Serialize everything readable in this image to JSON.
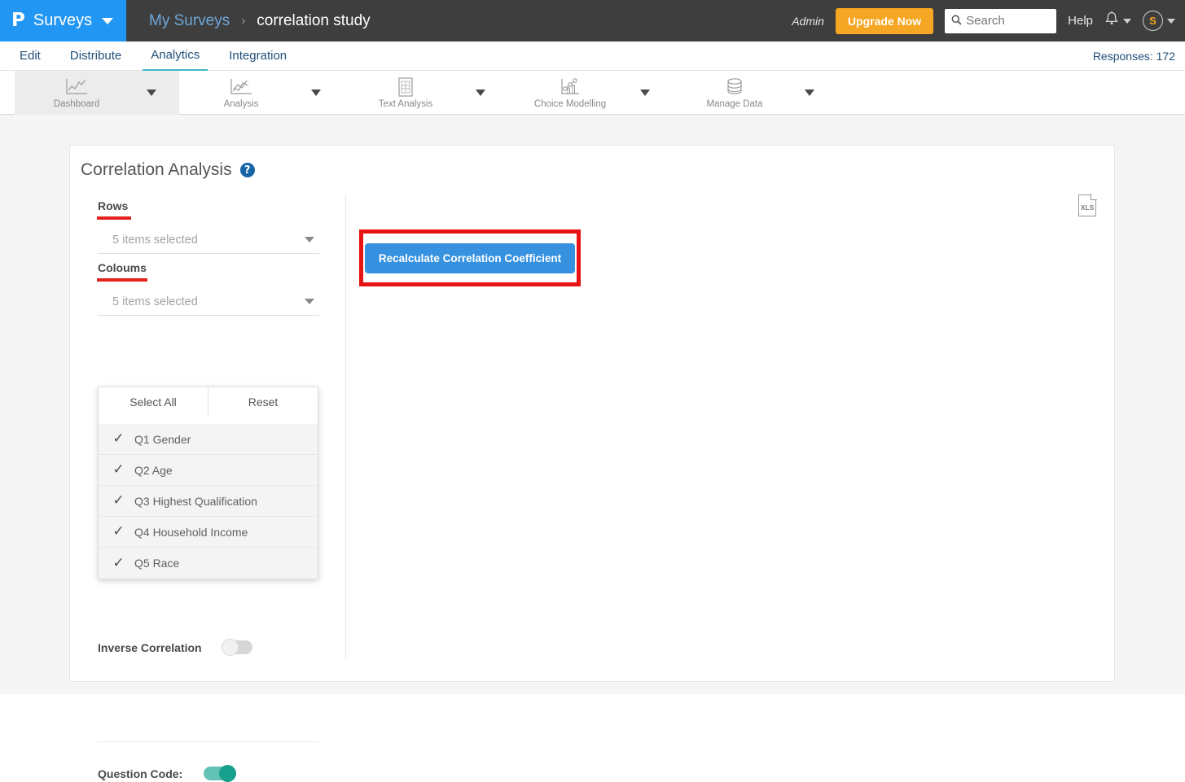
{
  "header": {
    "brand_logo": "P",
    "brand_label": "Surveys",
    "breadcrumb_root": "My Surveys",
    "breadcrumb_separator": "›",
    "breadcrumb_current": "correlation study",
    "admin_label": "Admin",
    "upgrade_label": "Upgrade Now",
    "search_placeholder": "Search",
    "search_value": "",
    "search_icon": "⌕",
    "help_label": "Help",
    "bell_icon": "bell-icon",
    "avatar_initial": "S",
    "brand_color": "#2196f3",
    "bar_color": "#3e3e3e",
    "upgrade_color": "#f5a623"
  },
  "nav": {
    "items": [
      {
        "label": "Edit",
        "active": false
      },
      {
        "label": "Distribute",
        "active": false
      },
      {
        "label": "Analytics",
        "active": true
      },
      {
        "label": "Integration",
        "active": false
      }
    ],
    "responses_label": "Responses: 172",
    "active_underline_color": "#3cb8c4"
  },
  "toolbar": {
    "tiles": [
      {
        "label": "Dashboard",
        "icon": "line-chart-icon",
        "active": true
      },
      {
        "label": "Analysis",
        "icon": "scatter-chart-icon",
        "active": false
      },
      {
        "label": "Text Analysis",
        "icon": "document-grid-icon",
        "active": false
      },
      {
        "label": "Choice Modelling",
        "icon": "bubble-bar-chart-icon",
        "active": false
      },
      {
        "label": "Manage Data",
        "icon": "database-icon",
        "active": false
      }
    ]
  },
  "panel": {
    "title": "Correlation Analysis",
    "help_icon_glyph": "?",
    "rows": {
      "label": "Rows",
      "value": "5 items selected"
    },
    "columns": {
      "label": "Coloums",
      "value": "5 items selected"
    },
    "dropdown": {
      "select_all_label": "Select All",
      "reset_label": "Reset",
      "check_glyph": "✓",
      "items": [
        {
          "label": "Q1 Gender",
          "checked": true
        },
        {
          "label": "Q2 Age",
          "checked": true
        },
        {
          "label": "Q3 Highest Qualification",
          "checked": true
        },
        {
          "label": "Q4 Household Income",
          "checked": true
        },
        {
          "label": "Q5 Race",
          "checked": true
        }
      ]
    },
    "inverse_correlation": {
      "label": "Inverse Correlation",
      "enabled": false
    },
    "question_code": {
      "label": "Question Code:",
      "enabled": true,
      "on_color": "#17a08c"
    },
    "export_icon_label": "XLS",
    "recalculate_label": "Recalculate Correlation Coefficient",
    "recalculate_button_color": "#3692e0",
    "highlight_color": "#e81414",
    "label_underline_color": "#e4221b"
  }
}
